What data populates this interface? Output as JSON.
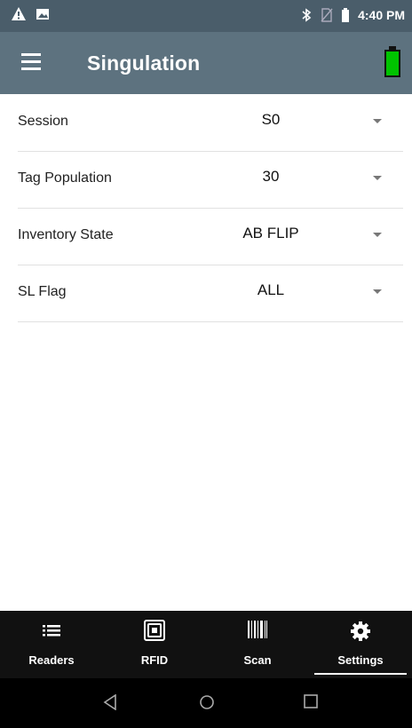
{
  "status_bar": {
    "time": "4:40 PM",
    "left_icons": [
      "warning-icon",
      "image-icon"
    ],
    "right_icons": [
      "bluetooth-icon",
      "no-sim-icon",
      "battery-status-icon"
    ]
  },
  "app_bar": {
    "title": "Singulation",
    "battery_color": "#00c400"
  },
  "settings": [
    {
      "label": "Session",
      "value": "S0"
    },
    {
      "label": "Tag Population",
      "value": "30"
    },
    {
      "label": "Inventory State",
      "value": "AB FLIP"
    },
    {
      "label": "SL Flag",
      "value": "ALL"
    }
  ],
  "bottom_nav": [
    {
      "label": "Readers",
      "icon": "list-icon"
    },
    {
      "label": "RFID",
      "icon": "rfid-icon"
    },
    {
      "label": "Scan",
      "icon": "barcode-icon"
    },
    {
      "label": "Settings",
      "icon": "gear-icon",
      "active": true
    }
  ],
  "system_nav": [
    "back-icon",
    "home-icon",
    "recents-icon"
  ]
}
